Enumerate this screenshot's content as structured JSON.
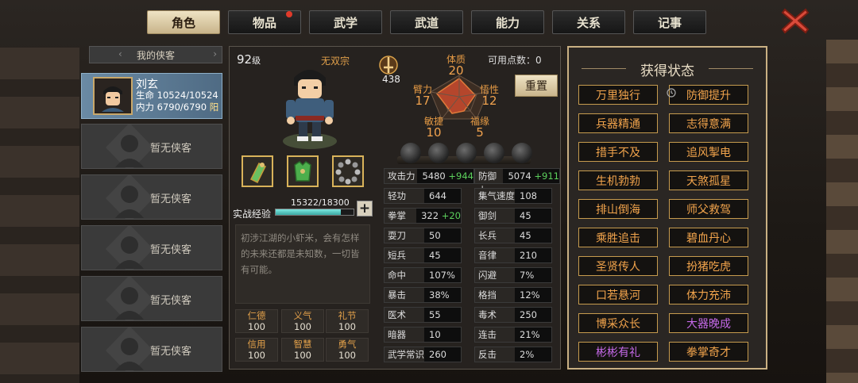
{
  "tabs": [
    {
      "label": "角色",
      "active": true
    },
    {
      "label": "物品",
      "badge": true
    },
    {
      "label": "武学"
    },
    {
      "label": "武道"
    },
    {
      "label": "能力"
    },
    {
      "label": "关系"
    },
    {
      "label": "记事"
    }
  ],
  "close_icon": "close-x-icon",
  "list": {
    "header": "我的侠客",
    "empty_label": "暂无侠客"
  },
  "hero": {
    "name": "刘玄",
    "hp": "生命 10524/10524",
    "mp": "内力 6790/6790",
    "mp_tag": "阳"
  },
  "profile": {
    "level": "92",
    "level_unit": "级",
    "sect": "无双宗",
    "points_label": "可用点数：",
    "points": "0",
    "weapon_score": "438",
    "reset": "重置",
    "radar": {
      "体质": {
        "label": "体质",
        "value": "20"
      },
      "悟性": {
        "label": "悟性",
        "value": "12"
      },
      "福缘": {
        "label": "福缘",
        "value": "5"
      },
      "敏捷": {
        "label": "敏捷",
        "value": "10"
      },
      "臂力": {
        "label": "臂力",
        "value": "17"
      }
    },
    "exp_label": "实战经验",
    "exp_value": "15322/18300",
    "exp_fraction": 0.837,
    "description": "初涉江湖的小虾米，会有怎样的未来还都是未知数，一切皆有可能。"
  },
  "virtues": [
    {
      "k": "仁德",
      "v": "100"
    },
    {
      "k": "义气",
      "v": "100"
    },
    {
      "k": "礼节",
      "v": "100"
    },
    {
      "k": "信用",
      "v": "100"
    },
    {
      "k": "智慧",
      "v": "100"
    },
    {
      "k": "勇气",
      "v": "100"
    }
  ],
  "stats_left": [
    {
      "k": "攻击力",
      "v": "5480",
      "b": "+944"
    },
    {
      "k": "轻功",
      "v": "644",
      "b": ""
    },
    {
      "k": "拳掌",
      "v": "322",
      "b": "+20"
    },
    {
      "k": "耍刀",
      "v": "50",
      "b": ""
    },
    {
      "k": "短兵",
      "v": "45",
      "b": ""
    },
    {
      "k": "命中",
      "v": "107%",
      "b": ""
    },
    {
      "k": "暴击",
      "v": "38%",
      "b": ""
    },
    {
      "k": "医术",
      "v": "55",
      "b": ""
    },
    {
      "k": "暗器",
      "v": "10",
      "b": ""
    },
    {
      "k": "武学常识",
      "v": "260",
      "b": ""
    }
  ],
  "stats_right": [
    {
      "k": "防御力",
      "v": "5074",
      "b": "+911"
    },
    {
      "k": "集气速度",
      "v": "108",
      "b": ""
    },
    {
      "k": "御剑",
      "v": "45",
      "b": ""
    },
    {
      "k": "长兵",
      "v": "45",
      "b": ""
    },
    {
      "k": "音律",
      "v": "210",
      "b": ""
    },
    {
      "k": "闪避",
      "v": "7%",
      "b": ""
    },
    {
      "k": "格挡",
      "v": "12%",
      "b": ""
    },
    {
      "k": "毒术",
      "v": "250",
      "b": ""
    },
    {
      "k": "连击",
      "v": "21%",
      "b": ""
    },
    {
      "k": "反击",
      "v": "2%",
      "b": ""
    }
  ],
  "status_title": "获得状态",
  "statuses": [
    {
      "label": "万里独行",
      "color": "orange"
    },
    {
      "label": "防御提升",
      "color": "orange"
    },
    {
      "label": "兵器精通",
      "color": "orange"
    },
    {
      "label": "志得意满",
      "color": "orange"
    },
    {
      "label": "措手不及",
      "color": "orange"
    },
    {
      "label": "追风掣电",
      "color": "orange"
    },
    {
      "label": "生机勃勃",
      "color": "orange"
    },
    {
      "label": "天煞孤星",
      "color": "orange"
    },
    {
      "label": "排山倒海",
      "color": "orange"
    },
    {
      "label": "师父救驾",
      "color": "orange"
    },
    {
      "label": "乘胜追击",
      "color": "orange"
    },
    {
      "label": "碧血丹心",
      "color": "orange"
    },
    {
      "label": "圣贤传人",
      "color": "orange"
    },
    {
      "label": "扮猪吃虎",
      "color": "orange"
    },
    {
      "label": "口若悬河",
      "color": "orange"
    },
    {
      "label": "体力充沛",
      "color": "orange"
    },
    {
      "label": "博采众长",
      "color": "orange"
    },
    {
      "label": "大器晚成",
      "color": "purple"
    },
    {
      "label": "彬彬有礼",
      "color": "purple"
    },
    {
      "label": "拳掌奇才",
      "color": "orange"
    }
  ],
  "colors": {
    "orange": "#f2a44c",
    "purple": "#c569e8",
    "accent": "#c9b083"
  }
}
